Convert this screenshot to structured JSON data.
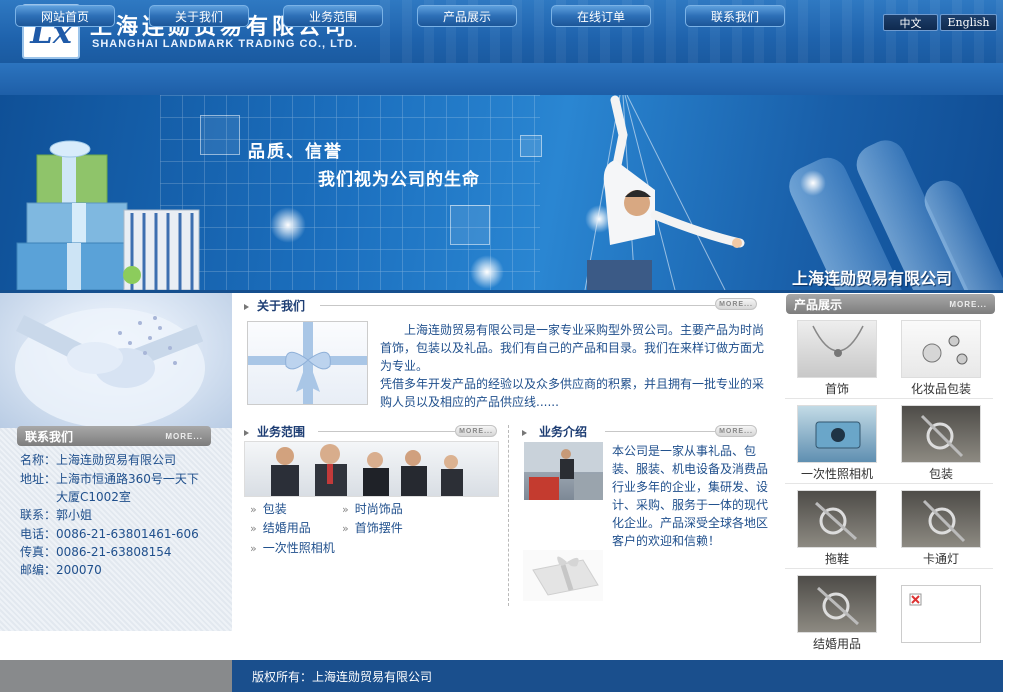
{
  "header": {
    "logo_mark": "Lx",
    "company_cn": "上海连勋贸易有限公司",
    "company_en": "SHANGHAI LANDMARK TRADING CO., LTD.",
    "lang_cn": "中文",
    "lang_en": "English"
  },
  "nav": [
    "网站首页",
    "关于我们",
    "业务范围",
    "产品展示",
    "在线订单",
    "联系我们"
  ],
  "banner": {
    "slogan1": "品质、信誉",
    "slogan2": "我们视为公司的生命",
    "company": "上海连勋贸易有限公司"
  },
  "more_label": "MORE...",
  "contact": {
    "title": "联系我们",
    "lines": [
      "名称：上海连勋贸易有限公司",
      "地址：上海市恒通路360号一天下",
      "　　　大厦C1002室",
      "联系：郭小姐",
      "电话：0086-21-63801461-606",
      "传真：0086-21-63808154",
      "邮编：200070"
    ]
  },
  "about": {
    "title": "关于我们",
    "text1": "上海连勋贸易有限公司是一家专业采购型外贸公司。主要产品为时尚首饰，包装以及礼品。我们有自己的产品和目录。我们在来样订做方面尤为专业。",
    "text2": "凭借多年开发产品的经验以及众多供应商的积累，并且拥有一批专业的采购人员以及相应的产品供应线......"
  },
  "business": {
    "title": "业务范围",
    "items": [
      "包装",
      "时尚饰品",
      "结婚用品",
      "首饰摆件",
      "一次性照相机"
    ]
  },
  "intro": {
    "title": "业务介绍",
    "text": "本公司是一家从事礼品、包装、服装、机电设备及消费品行业多年的企业，集研发、设计、采购、服务于一体的现代化企业。产品深受全球各地区客户的欢迎和信赖！"
  },
  "products": {
    "title": "产品展示",
    "items": [
      "首饰",
      "化妆品包装",
      "一次性照相机",
      "包装",
      "拖鞋",
      "卡通灯",
      "结婚用品",
      ""
    ]
  },
  "footer": {
    "copyright": "版权所有：上海连勋贸易有限公司"
  }
}
